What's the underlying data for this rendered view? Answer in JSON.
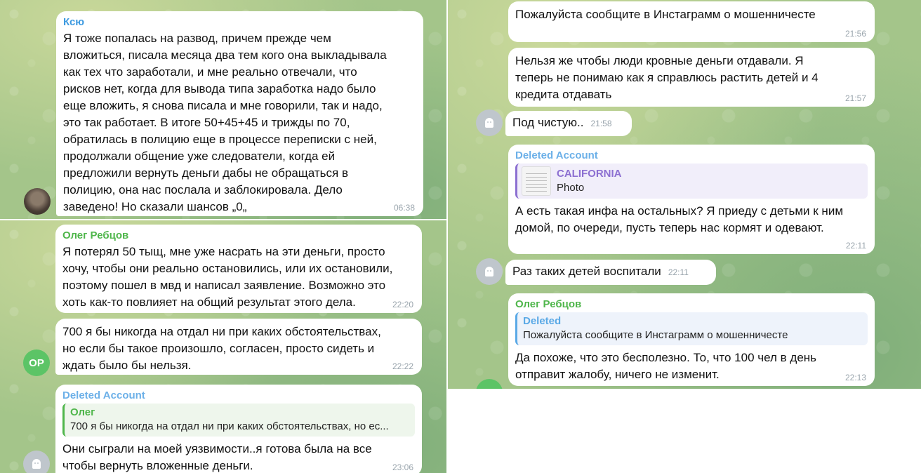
{
  "messages": {
    "m1": {
      "sender": "Ксю",
      "sender_color": "#3d9ae0",
      "lines": [
        "Я тоже попалась на развод, причем прежде чем",
        "вложиться, писала месяца два тем кого она выкладывала",
        "как тех что заработали, и мне реально отвечали, что",
        "рисков нет, когда для вывода типа заработка надо было",
        "еще вложить, я снова писала и мне говорили, так и надо,",
        "это так работает. В итоге 50+45+45 и трижды по 70,",
        "обратилась в полицию еще в процессе переписки с ней,",
        "продолжали общение уже следователи, когда ей",
        "предложили вернуть деньги дабы не обращаться в",
        "полицию, она нас послала и заблокировала. Дело",
        "заведено! Но сказали шансов „0„"
      ],
      "time": "06:38"
    },
    "m2": {
      "sender": "Олег Ребцов",
      "sender_color": "#4fb64b",
      "lines": [
        "Я потерял 50 тыщ, мне уже насрать на эти деньги, просто",
        "хочу, чтобы они реально остановились, или их остановили,",
        "поэтому пошел в мвд и написал заявление. Возможно это",
        "хоть как-то повлияет на общий результат этого дела."
      ],
      "time": "22:20"
    },
    "m3": {
      "lines": [
        "700 я бы никогда на отдал ни при каких обстоятельствах,",
        "но если бы такое произошло, согласен, просто сидеть и",
        "ждать было бы нельзя."
      ],
      "time": "22:22",
      "avatar_initials": "OP"
    },
    "m4": {
      "sender": "Deleted Account",
      "sender_color": "#6cb0e8",
      "quote_name": "Олег",
      "quote_color": "#4fb64b",
      "quote_text": "700 я бы никогда на отдал ни при каких обстоятельствах, но ес...",
      "lines": [
        "Они сыграли на моей уязвимости..я готова была на все",
        "чтобы вернуть вложенные деньги."
      ],
      "time": "23:06"
    },
    "r1": {
      "lines": [
        "Пожалуйста сообщите в Инстаграмм о мошенничесте"
      ],
      "time": "21:56"
    },
    "r2": {
      "lines": [
        "Нельзя же чтобы люди кровные деньги отдавали. Я",
        "теперь не понимаю как я справлюсь растить детей и 4",
        "кредита отдавать"
      ],
      "time": "21:57"
    },
    "r3": {
      "text": "Под чистую..",
      "time": "21:58"
    },
    "r4": {
      "sender": "Deleted Account",
      "sender_color": "#6cb0e8",
      "quote_name": "CALIFORNIA",
      "quote_color": "#8c6fd1",
      "quote_text": "Photo",
      "lines": [
        "А есть такая инфа на остальных? Я приеду с детьми к ним",
        "домой, по очереди, пусть теперь нас кормят и одевают."
      ],
      "time": "22:11"
    },
    "r5": {
      "text": "Раз таких детей воспитали",
      "time": "22:11"
    },
    "r6": {
      "sender": "Олег Ребцов",
      "sender_color": "#4fb64b",
      "quote_name": "Deleted",
      "quote_color": "#5aa9e6",
      "quote_text": "Пожалуйста сообщите в Инстаграмм о мошенничесте",
      "lines": [
        "Да похоже, что это бесполезно. То, что 100 чел в день",
        "отправит жалобу, ничего не изменит."
      ],
      "time": "22:13"
    }
  }
}
